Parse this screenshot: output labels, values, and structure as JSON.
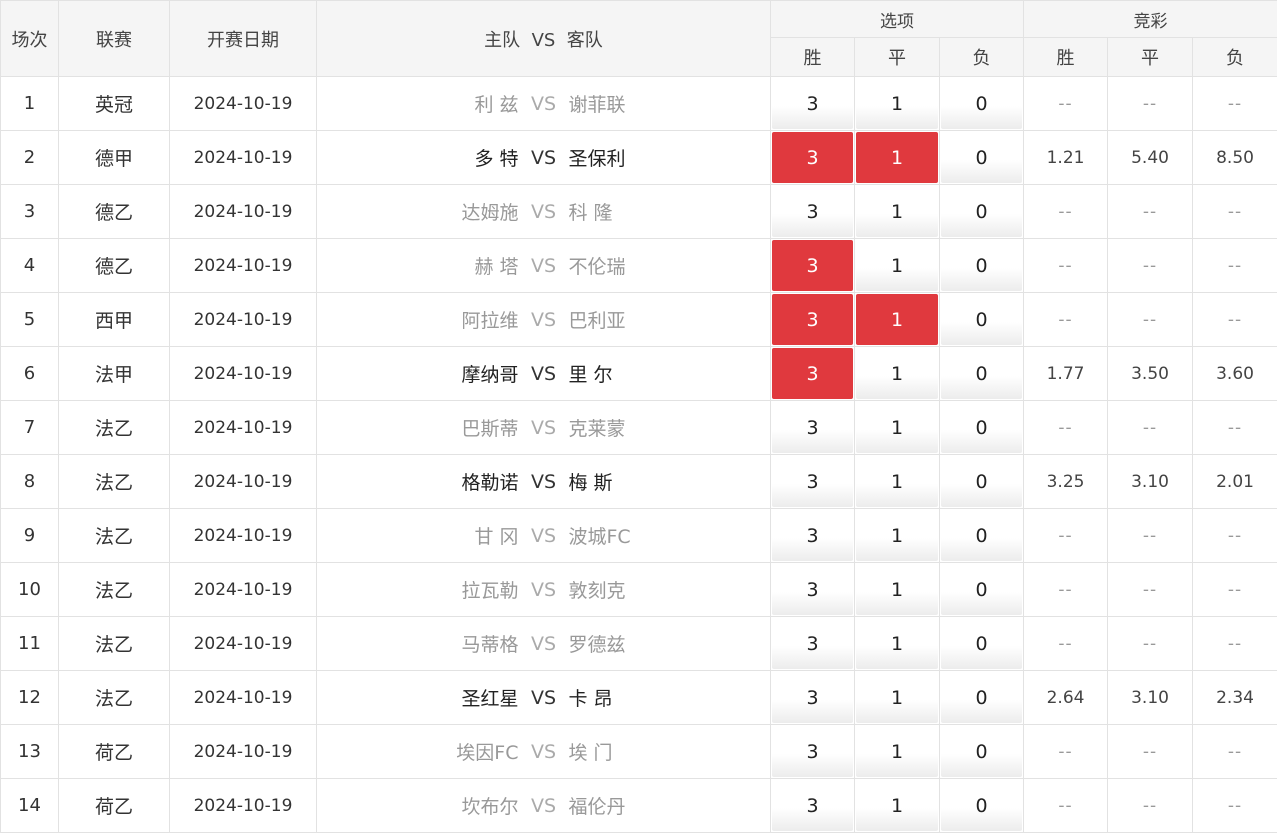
{
  "header": {
    "idx": "场次",
    "league": "联赛",
    "date": "开赛日期",
    "match": "主队  VS  客队",
    "options_group": "选项",
    "jingcai_group": "竞彩",
    "win": "胜",
    "draw": "平",
    "lose": "负"
  },
  "rows": [
    {
      "idx": "1",
      "league": "英冠",
      "date": "2024-10-19",
      "home": "利 兹",
      "vs": "VS",
      "away": "谢菲联",
      "opt_win": "3",
      "opt_draw": "1",
      "opt_lose": "0",
      "win_sel": false,
      "draw_sel": false,
      "lose_sel": false,
      "active": false,
      "odds_win": "--",
      "odds_draw": "--",
      "odds_lose": "--"
    },
    {
      "idx": "2",
      "league": "德甲",
      "date": "2024-10-19",
      "home": "多 特",
      "vs": "VS",
      "away": "圣保利",
      "opt_win": "3",
      "opt_draw": "1",
      "opt_lose": "0",
      "win_sel": true,
      "draw_sel": true,
      "lose_sel": false,
      "active": true,
      "odds_win": "1.21",
      "odds_draw": "5.40",
      "odds_lose": "8.50"
    },
    {
      "idx": "3",
      "league": "德乙",
      "date": "2024-10-19",
      "home": "达姆施",
      "vs": "VS",
      "away": "科 隆",
      "opt_win": "3",
      "opt_draw": "1",
      "opt_lose": "0",
      "win_sel": false,
      "draw_sel": false,
      "lose_sel": false,
      "active": false,
      "odds_win": "--",
      "odds_draw": "--",
      "odds_lose": "--"
    },
    {
      "idx": "4",
      "league": "德乙",
      "date": "2024-10-19",
      "home": "赫 塔",
      "vs": "VS",
      "away": "不伦瑞",
      "opt_win": "3",
      "opt_draw": "1",
      "opt_lose": "0",
      "win_sel": true,
      "draw_sel": false,
      "lose_sel": false,
      "active": false,
      "odds_win": "--",
      "odds_draw": "--",
      "odds_lose": "--"
    },
    {
      "idx": "5",
      "league": "西甲",
      "date": "2024-10-19",
      "home": "阿拉维",
      "vs": "VS",
      "away": "巴利亚",
      "opt_win": "3",
      "opt_draw": "1",
      "opt_lose": "0",
      "win_sel": true,
      "draw_sel": true,
      "lose_sel": false,
      "active": false,
      "odds_win": "--",
      "odds_draw": "--",
      "odds_lose": "--"
    },
    {
      "idx": "6",
      "league": "法甲",
      "date": "2024-10-19",
      "home": "摩纳哥",
      "vs": "VS",
      "away": "里 尔",
      "opt_win": "3",
      "opt_draw": "1",
      "opt_lose": "0",
      "win_sel": true,
      "draw_sel": false,
      "lose_sel": false,
      "active": true,
      "odds_win": "1.77",
      "odds_draw": "3.50",
      "odds_lose": "3.60"
    },
    {
      "idx": "7",
      "league": "法乙",
      "date": "2024-10-19",
      "home": "巴斯蒂",
      "vs": "VS",
      "away": "克莱蒙",
      "opt_win": "3",
      "opt_draw": "1",
      "opt_lose": "0",
      "win_sel": false,
      "draw_sel": false,
      "lose_sel": false,
      "active": false,
      "odds_win": "--",
      "odds_draw": "--",
      "odds_lose": "--"
    },
    {
      "idx": "8",
      "league": "法乙",
      "date": "2024-10-19",
      "home": "格勒诺",
      "vs": "VS",
      "away": "梅 斯",
      "opt_win": "3",
      "opt_draw": "1",
      "opt_lose": "0",
      "win_sel": false,
      "draw_sel": false,
      "lose_sel": false,
      "active": true,
      "odds_win": "3.25",
      "odds_draw": "3.10",
      "odds_lose": "2.01"
    },
    {
      "idx": "9",
      "league": "法乙",
      "date": "2024-10-19",
      "home": "甘 冈",
      "vs": "VS",
      "away": "波城FC",
      "opt_win": "3",
      "opt_draw": "1",
      "opt_lose": "0",
      "win_sel": false,
      "draw_sel": false,
      "lose_sel": false,
      "active": false,
      "odds_win": "--",
      "odds_draw": "--",
      "odds_lose": "--"
    },
    {
      "idx": "10",
      "league": "法乙",
      "date": "2024-10-19",
      "home": "拉瓦勒",
      "vs": "VS",
      "away": "敦刻克",
      "opt_win": "3",
      "opt_draw": "1",
      "opt_lose": "0",
      "win_sel": false,
      "draw_sel": false,
      "lose_sel": false,
      "active": false,
      "odds_win": "--",
      "odds_draw": "--",
      "odds_lose": "--"
    },
    {
      "idx": "11",
      "league": "法乙",
      "date": "2024-10-19",
      "home": "马蒂格",
      "vs": "VS",
      "away": "罗德兹",
      "opt_win": "3",
      "opt_draw": "1",
      "opt_lose": "0",
      "win_sel": false,
      "draw_sel": false,
      "lose_sel": false,
      "active": false,
      "odds_win": "--",
      "odds_draw": "--",
      "odds_lose": "--"
    },
    {
      "idx": "12",
      "league": "法乙",
      "date": "2024-10-19",
      "home": "圣红星",
      "vs": "VS",
      "away": "卡 昂",
      "opt_win": "3",
      "opt_draw": "1",
      "opt_lose": "0",
      "win_sel": false,
      "draw_sel": false,
      "lose_sel": false,
      "active": true,
      "odds_win": "2.64",
      "odds_draw": "3.10",
      "odds_lose": "2.34"
    },
    {
      "idx": "13",
      "league": "荷乙",
      "date": "2024-10-19",
      "home": "埃因FC",
      "vs": "VS",
      "away": "埃 门",
      "opt_win": "3",
      "opt_draw": "1",
      "opt_lose": "0",
      "win_sel": false,
      "draw_sel": false,
      "lose_sel": false,
      "active": false,
      "odds_win": "--",
      "odds_draw": "--",
      "odds_lose": "--"
    },
    {
      "idx": "14",
      "league": "荷乙",
      "date": "2024-10-19",
      "home": "坎布尔",
      "vs": "VS",
      "away": "福伦丹",
      "opt_win": "3",
      "opt_draw": "1",
      "opt_lose": "0",
      "win_sel": false,
      "draw_sel": false,
      "lose_sel": false,
      "active": false,
      "odds_win": "--",
      "odds_draw": "--",
      "odds_lose": "--"
    }
  ],
  "colors": {
    "selected": "#e0393e",
    "header_bg": "#f5f5f5",
    "border": "#e2e2e2",
    "inactive_team": "#999999"
  }
}
